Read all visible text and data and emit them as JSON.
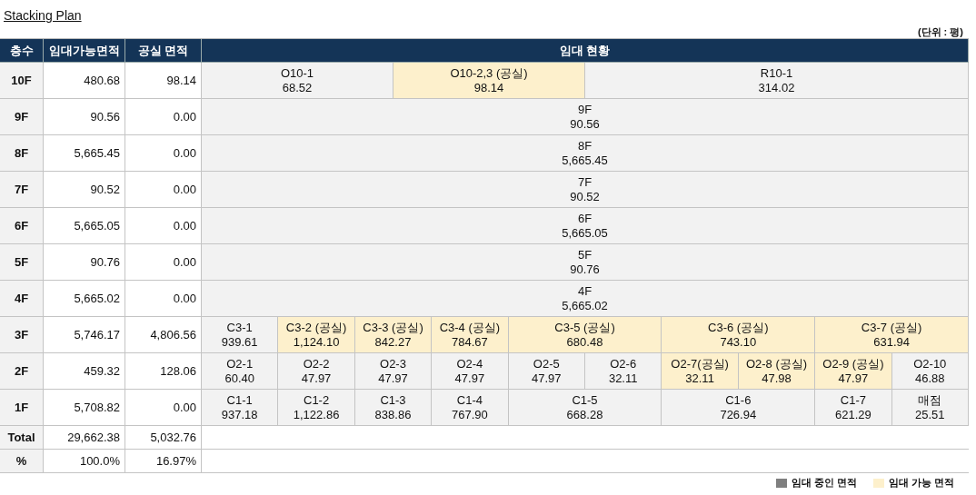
{
  "title": "Stacking Plan",
  "unit_note": "(단위 : 평)",
  "columns": {
    "floor": "층수",
    "leasable": "임대가능면적",
    "vacant": "공실 면적",
    "status": "임대 현황"
  },
  "floors": [
    {
      "floor": "10F",
      "leasable": "480.68",
      "vacant_area": "98.14",
      "units": [
        {
          "name": "O10-1",
          "area": "68.52",
          "vacant": false
        },
        {
          "name": "O10-2,3 (공실)",
          "area": "98.14",
          "vacant": true
        },
        {
          "name": "R10-1",
          "area": "314.02",
          "vacant": false
        }
      ]
    },
    {
      "floor": "9F",
      "leasable": "90.56",
      "vacant_area": "0.00",
      "units": [
        {
          "name": "9F",
          "area": "90.56",
          "vacant": false
        }
      ]
    },
    {
      "floor": "8F",
      "leasable": "5,665.45",
      "vacant_area": "0.00",
      "units": [
        {
          "name": "8F",
          "area": "5,665.45",
          "vacant": false
        }
      ]
    },
    {
      "floor": "7F",
      "leasable": "90.52",
      "vacant_area": "0.00",
      "units": [
        {
          "name": "7F",
          "area": "90.52",
          "vacant": false
        }
      ]
    },
    {
      "floor": "6F",
      "leasable": "5,665.05",
      "vacant_area": "0.00",
      "units": [
        {
          "name": "6F",
          "area": "5,665.05",
          "vacant": false
        }
      ]
    },
    {
      "floor": "5F",
      "leasable": "90.76",
      "vacant_area": "0.00",
      "units": [
        {
          "name": "5F",
          "area": "90.76",
          "vacant": false
        }
      ]
    },
    {
      "floor": "4F",
      "leasable": "5,665.02",
      "vacant_area": "0.00",
      "units": [
        {
          "name": "4F",
          "area": "5,665.02",
          "vacant": false
        }
      ]
    },
    {
      "floor": "3F",
      "leasable": "5,746.17",
      "vacant_area": "4,806.56",
      "units": [
        {
          "name": "C3-1",
          "area": "939.61",
          "vacant": false
        },
        {
          "name": "C3-2 (공실)",
          "area": "1,124.10",
          "vacant": true
        },
        {
          "name": "C3-3 (공실)",
          "area": "842.27",
          "vacant": true
        },
        {
          "name": "C3-4 (공실)",
          "area": "784.67",
          "vacant": true
        },
        {
          "name": "C3-5 (공실)",
          "area": "680.48",
          "vacant": true
        },
        {
          "name": "C3-6 (공실)",
          "area": "743.10",
          "vacant": true
        },
        {
          "name": "C3-7 (공실)",
          "area": "631.94",
          "vacant": true
        }
      ]
    },
    {
      "floor": "2F",
      "leasable": "459.32",
      "vacant_area": "128.06",
      "units": [
        {
          "name": "O2-1",
          "area": "60.40",
          "vacant": false
        },
        {
          "name": "O2-2",
          "area": "47.97",
          "vacant": false
        },
        {
          "name": "O2-3",
          "area": "47.97",
          "vacant": false
        },
        {
          "name": "O2-4",
          "area": "47.97",
          "vacant": false
        },
        {
          "name": "O2-5",
          "area": "47.97",
          "vacant": false
        },
        {
          "name": "O2-6",
          "area": "32.11",
          "vacant": false
        },
        {
          "name": "O2-7(공실)",
          "area": "32.11",
          "vacant": true
        },
        {
          "name": "O2-8 (공실)",
          "area": "47.98",
          "vacant": true
        },
        {
          "name": "O2-9 (공실)",
          "area": "47.97",
          "vacant": true
        },
        {
          "name": "O2-10",
          "area": "46.88",
          "vacant": false
        }
      ]
    },
    {
      "floor": "1F",
      "leasable": "5,708.82",
      "vacant_area": "0.00",
      "units": [
        {
          "name": "C1-1",
          "area": "937.18",
          "vacant": false
        },
        {
          "name": "C1-2",
          "area": "1,122.86",
          "vacant": false
        },
        {
          "name": "C1-3",
          "area": "838.86",
          "vacant": false
        },
        {
          "name": "C1-4",
          "area": "767.90",
          "vacant": false
        },
        {
          "name": "C1-5",
          "area": "668.28",
          "vacant": false
        },
        {
          "name": "C1-6",
          "area": "726.94",
          "vacant": false
        },
        {
          "name": "C1-7",
          "area": "621.29",
          "vacant": false
        },
        {
          "name": "매점",
          "area": "25.51",
          "vacant": false
        }
      ]
    }
  ],
  "summary": [
    {
      "label": "Total",
      "leasable": "29,662.38",
      "vacant_area": "5,032.76"
    },
    {
      "label": "%",
      "leasable": "100.0%",
      "vacant_area": "16.97%"
    }
  ],
  "legend": [
    {
      "label": "임대 중인 면적",
      "color": "#7f7f7f"
    },
    {
      "label": "임대 가능 면적",
      "color": "#fdf0cc"
    }
  ]
}
